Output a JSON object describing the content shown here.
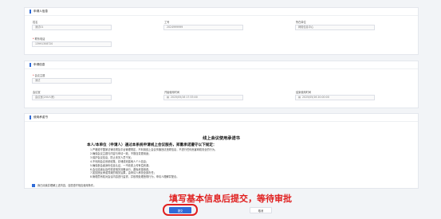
{
  "applicant": {
    "section_title": "申请人信息",
    "name_label": "姓名",
    "name_value": "测试01",
    "empno_label": "工号",
    "empno_value": "2024999999",
    "dept_label": "所在单位",
    "dept_value": "网络信息中心",
    "phone_label": "联系电话",
    "phone_value": "13991308720"
  },
  "meeting": {
    "section_title": "申请信息",
    "topic_label": "会议主题",
    "topic_value": "测试",
    "room_label": "会议室",
    "room_value": "会议室(200人房)",
    "start_label": "开始使用时间",
    "start_value": "2025/05/16 17:33:00",
    "end_label": "结束使用时间",
    "end_value": "2025/05/16 20:00:00"
  },
  "commitment": {
    "section_title": "使用承诺书",
    "doc_title": "线上会议使用承诺书",
    "intro": "本人/本单位（申请人）通过本系统申请线上会议服务，郑重承诺遵守以下规定：",
    "clauses": [
      "1.严格遵守国家法律法规及平台管理规定，不利用线上会议传播违法违规信息，不进行任何危害网络安全的行为。",
      "2.确保会议主题与内容与申请一致，不擅自变更用途；",
      "3.保护会议信息，防止未关人员干扰；",
      "4.不利用会议系统收集、存储或泄露他人个人信息；",
      "5.确保参会者身份信息认证，一不收费上传有偿资源；",
      "6.会议结束后及时检查相关设备运行，避免资源浪费。",
      "7.如因违反承诺导致的相关后果，由申请人承担全部责任；",
      "8.管理员有权对会议内容进行监督，并依规处理违规行为，申请人理解并配合。"
    ],
    "agree_text": "我已阅读并理解上述内容，自愿遵守相应使用条件。"
  },
  "annotation": "填写基本信息后提交，等待审批",
  "actions": {
    "submit_label": "提交",
    "cancel_label": "取消"
  },
  "colors": {
    "primary": "#2f6bd8",
    "annotation": "#e02020"
  }
}
